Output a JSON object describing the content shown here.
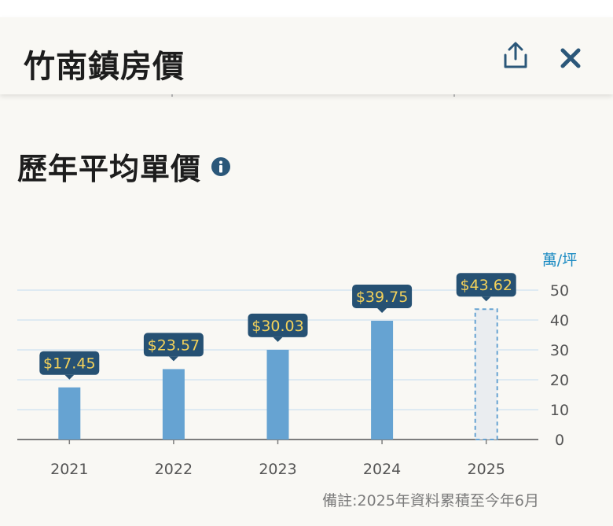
{
  "header": {
    "title": "竹南鎮房價",
    "share_icon": "share-icon",
    "close_icon": "close-icon"
  },
  "section": {
    "title": "歷年平均單價",
    "info_icon": "info-icon"
  },
  "chart_data": {
    "type": "bar",
    "title": "",
    "xlabel": "",
    "ylabel": "萬/坪",
    "categories": [
      "2021",
      "2022",
      "2023",
      "2024",
      "2025"
    ],
    "values": [
      17.45,
      23.57,
      30.03,
      39.75,
      43.62
    ],
    "data_labels": [
      "$17.45",
      "$23.57",
      "$30.03",
      "$39.75",
      "$43.62"
    ],
    "projected": [
      false,
      false,
      false,
      false,
      true
    ],
    "ylim": [
      0,
      50
    ],
    "yticks": [
      0,
      10,
      20,
      30,
      40,
      50
    ],
    "y_axis_position": "right",
    "grid": true,
    "bar_color": "#66a3d2",
    "projected_fill": "#eaedf0",
    "label_bg": "#265173",
    "label_text_color": "#f3d15a",
    "axis_label_color": "#1a8ac2"
  },
  "footnote": "備註:2025年資料累積至今年6月",
  "colors": {
    "page_bg": "#f9f8f4",
    "icon": "#2b5779",
    "title_text": "#1d1d1d"
  }
}
